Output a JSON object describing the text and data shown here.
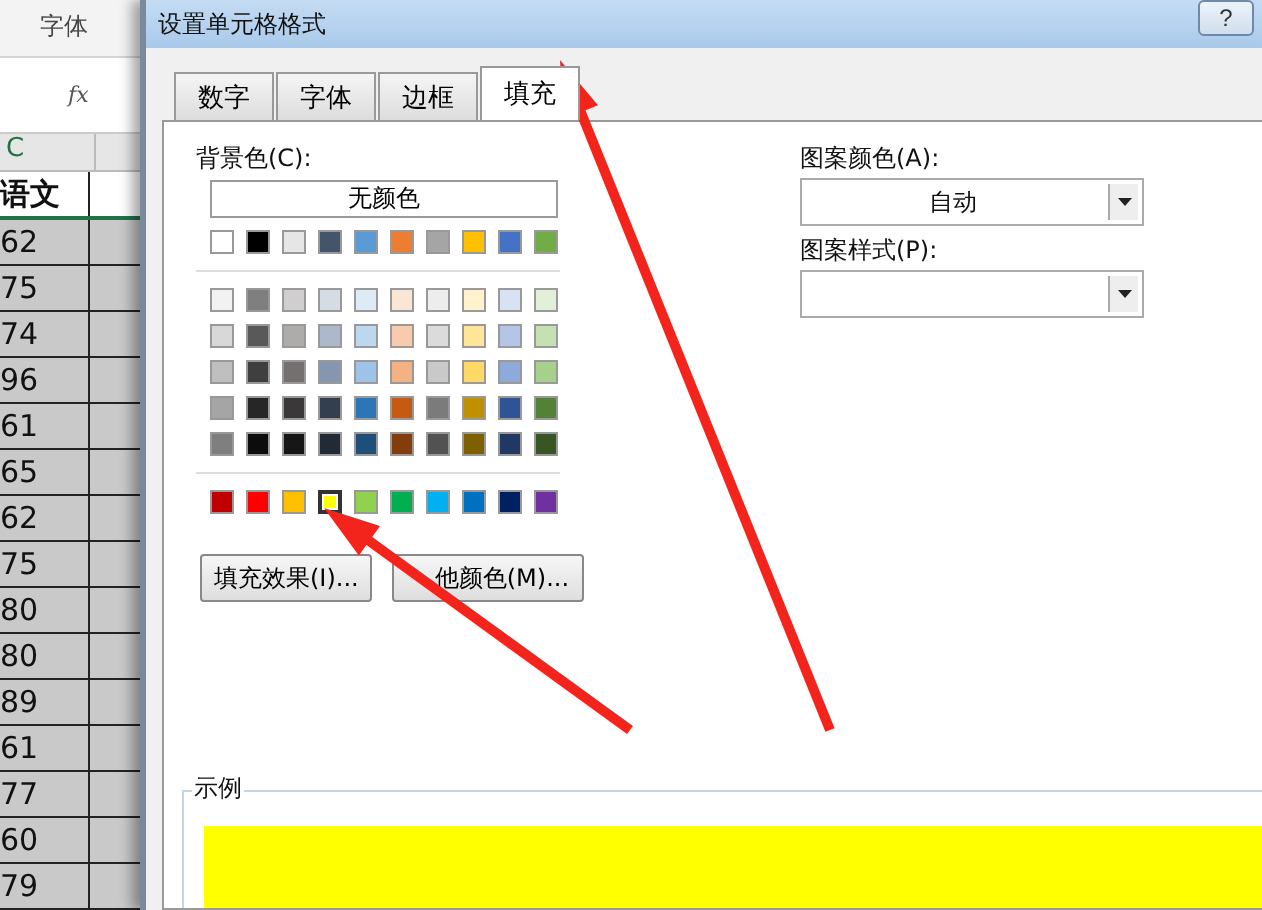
{
  "spreadsheet": {
    "ribbon_label": "字体",
    "formula_icon": "fx",
    "column_header": "C",
    "header_cell": "语文",
    "values": [
      "62",
      "75",
      "74",
      "96",
      "61",
      "65",
      "62",
      "75",
      "80",
      "80",
      "89",
      "61",
      "77",
      "60",
      "79"
    ]
  },
  "window": {
    "title": "设置单元格格式",
    "help_button": "?"
  },
  "tabs": [
    {
      "label": "数字",
      "selected": false
    },
    {
      "label": "字体",
      "selected": false
    },
    {
      "label": "边框",
      "selected": false
    },
    {
      "label": "填充",
      "selected": true
    }
  ],
  "background_color": {
    "label": "背景色(C):",
    "no_color_button": "无颜色",
    "theme_colors": [
      {
        "color": "#ffffff",
        "selected": false
      },
      {
        "color": "#000000",
        "selected": false
      },
      {
        "color": "#e7e6e6",
        "selected": false
      },
      {
        "color": "#44546a",
        "selected": false
      },
      {
        "color": "#5b9bd5",
        "selected": false
      },
      {
        "color": "#ed7d31",
        "selected": false
      },
      {
        "color": "#a5a5a5",
        "selected": false
      },
      {
        "color": "#ffc000",
        "selected": false
      },
      {
        "color": "#4472c4",
        "selected": false
      },
      {
        "color": "#70ad47",
        "selected": false
      }
    ],
    "shade_rows": [
      [
        {
          "color": "#f2f2f2",
          "selected": false
        },
        {
          "color": "#7f7f7f",
          "selected": false
        },
        {
          "color": "#d0cece",
          "selected": false
        },
        {
          "color": "#d6dce4",
          "selected": false
        },
        {
          "color": "#deebf6",
          "selected": false
        },
        {
          "color": "#fbe5d5",
          "selected": false
        },
        {
          "color": "#ededed",
          "selected": false
        },
        {
          "color": "#fff2cc",
          "selected": false
        },
        {
          "color": "#d9e2f3",
          "selected": false
        },
        {
          "color": "#e2efd9",
          "selected": false
        }
      ],
      [
        {
          "color": "#d8d8d8",
          "selected": false
        },
        {
          "color": "#595959",
          "selected": false
        },
        {
          "color": "#aeabab",
          "selected": false
        },
        {
          "color": "#adb9ca",
          "selected": false
        },
        {
          "color": "#bdd7ee",
          "selected": false
        },
        {
          "color": "#f7cbac",
          "selected": false
        },
        {
          "color": "#dbdbdb",
          "selected": false
        },
        {
          "color": "#fee599",
          "selected": false
        },
        {
          "color": "#b4c6e7",
          "selected": false
        },
        {
          "color": "#c5e0b3",
          "selected": false
        }
      ],
      [
        {
          "color": "#bfbfbf",
          "selected": false
        },
        {
          "color": "#3f3f3f",
          "selected": false
        },
        {
          "color": "#757070",
          "selected": false
        },
        {
          "color": "#8496b0",
          "selected": false
        },
        {
          "color": "#9dc3e6",
          "selected": false
        },
        {
          "color": "#f4b183",
          "selected": false
        },
        {
          "color": "#c9c9c9",
          "selected": false
        },
        {
          "color": "#ffd965",
          "selected": false
        },
        {
          "color": "#8eaadb",
          "selected": false
        },
        {
          "color": "#a8d08d",
          "selected": false
        }
      ],
      [
        {
          "color": "#a5a5a5",
          "selected": false
        },
        {
          "color": "#262626",
          "selected": false
        },
        {
          "color": "#3a3838",
          "selected": false
        },
        {
          "color": "#323f4f",
          "selected": false
        },
        {
          "color": "#2e75b5",
          "selected": false
        },
        {
          "color": "#c55a11",
          "selected": false
        },
        {
          "color": "#7b7b7b",
          "selected": false
        },
        {
          "color": "#bf9000",
          "selected": false
        },
        {
          "color": "#2f5496",
          "selected": false
        },
        {
          "color": "#538135",
          "selected": false
        }
      ],
      [
        {
          "color": "#7f7f7f",
          "selected": false
        },
        {
          "color": "#0c0c0c",
          "selected": false
        },
        {
          "color": "#171616",
          "selected": false
        },
        {
          "color": "#222a35",
          "selected": false
        },
        {
          "color": "#1f4e79",
          "selected": false
        },
        {
          "color": "#833c0b",
          "selected": false
        },
        {
          "color": "#525252",
          "selected": false
        },
        {
          "color": "#7f6000",
          "selected": false
        },
        {
          "color": "#1f3864",
          "selected": false
        },
        {
          "color": "#375623",
          "selected": false
        }
      ]
    ],
    "standard_colors": [
      {
        "color": "#c00000",
        "selected": false
      },
      {
        "color": "#ff0000",
        "selected": false
      },
      {
        "color": "#ffc000",
        "selected": false
      },
      {
        "color": "#ffff00",
        "selected": true
      },
      {
        "color": "#92d050",
        "selected": false
      },
      {
        "color": "#00b050",
        "selected": false
      },
      {
        "color": "#00b0f0",
        "selected": false
      },
      {
        "color": "#0070c0",
        "selected": false
      },
      {
        "color": "#002060",
        "selected": false
      },
      {
        "color": "#7030a0",
        "selected": false
      }
    ],
    "buttons": [
      "填充效果(I)...",
      "他颜色(M)..."
    ]
  },
  "pattern": {
    "color_label": "图案颜色(A):",
    "color_value": "自动",
    "style_label": "图案样式(P):"
  },
  "sample": {
    "label": "示例",
    "color": "#ffff00"
  }
}
